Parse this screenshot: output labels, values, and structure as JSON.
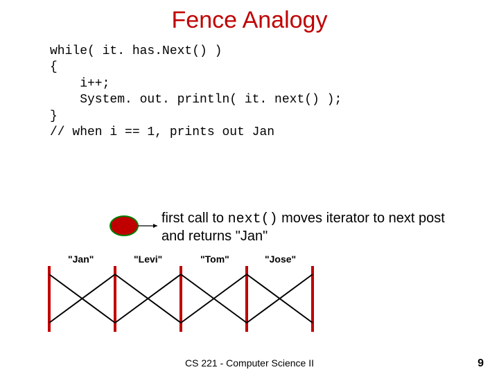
{
  "title": "Fence Analogy",
  "code": "while( it. has.Next() )\n{\n    i++;\n    System. out. println( it. next() );\n}\n// when i == 1, prints out Jan",
  "desc_pre": "first call to ",
  "desc_mono": "next()",
  "desc_post": " moves iterator to next post and returns \"Jan\"",
  "labels": [
    "\"Jan\"",
    "\"Levi\"",
    "\"Tom\"",
    "\"Jose\""
  ],
  "footer": "CS 221 - Computer Science II",
  "pagenum": "9"
}
